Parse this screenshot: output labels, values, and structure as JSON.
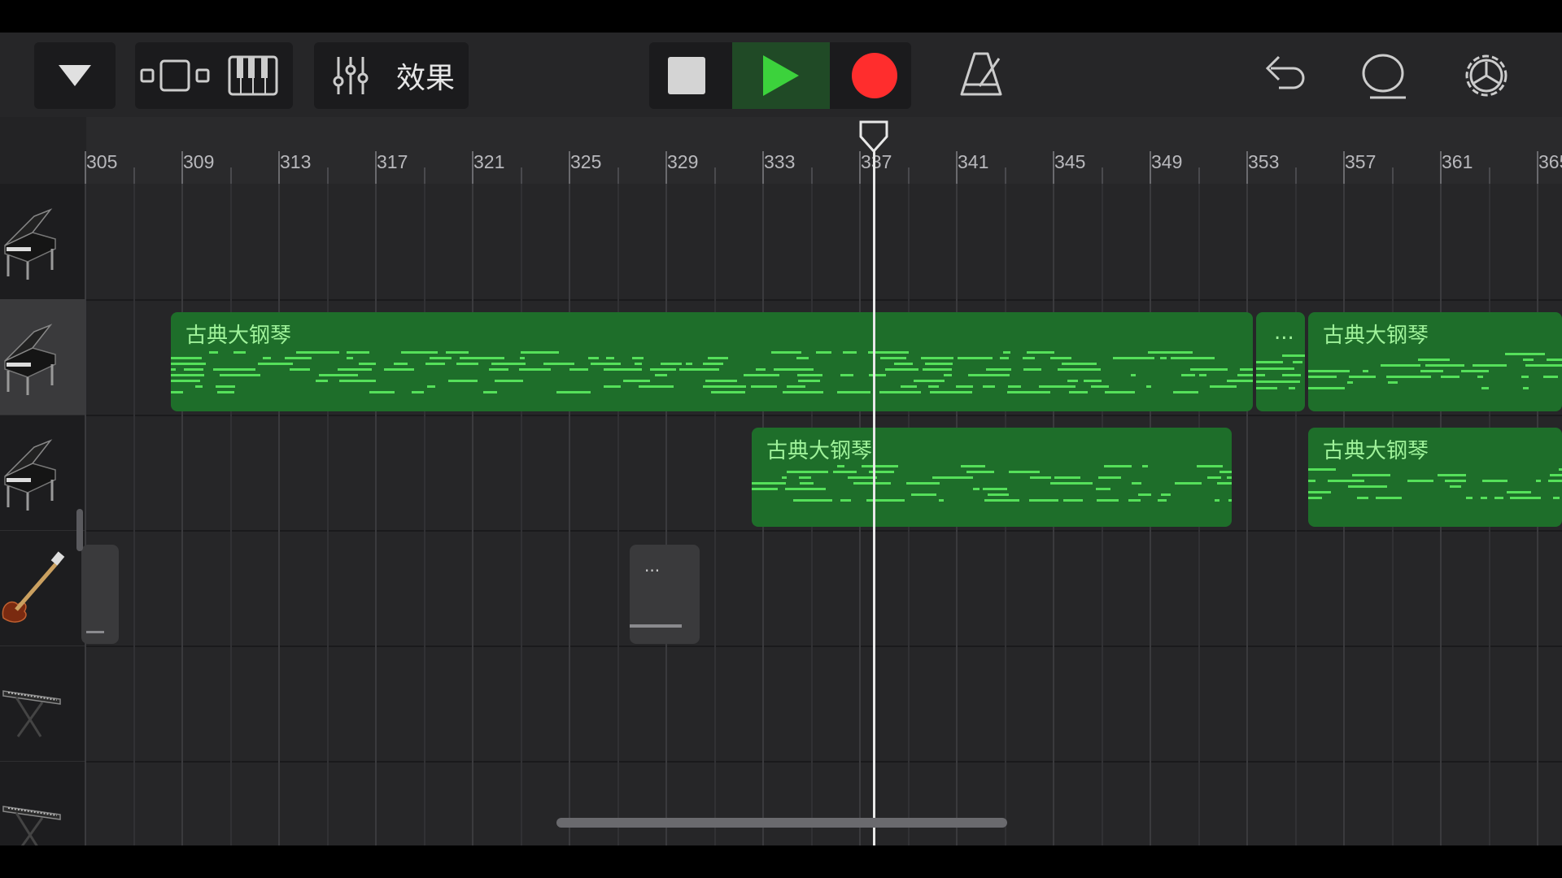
{
  "toolbar": {
    "effects_label": "效果"
  },
  "ruler": {
    "bars": [
      "305",
      "309",
      "313",
      "317",
      "321",
      "325",
      "329",
      "333",
      "337",
      "341",
      "345",
      "349",
      "353",
      "357",
      "361",
      "365"
    ]
  },
  "tracks": [
    {
      "instrument": "grand-piano"
    },
    {
      "instrument": "grand-piano",
      "selected": true
    },
    {
      "instrument": "grand-piano"
    },
    {
      "instrument": "electric-bass"
    },
    {
      "instrument": "synth-keyboard"
    },
    {
      "instrument": "synth-keyboard"
    }
  ],
  "regions": [
    {
      "label": "古典大钢琴"
    },
    {
      "label": "..."
    },
    {
      "label": "古典大钢琴"
    },
    {
      "label": "古典大钢琴"
    },
    {
      "label": "古典大钢琴"
    },
    {
      "label": "..."
    }
  ],
  "colors": {
    "region_green": "#1e6e2a",
    "note_green": "#55e05a",
    "play_green": "#3cd23c",
    "record_red": "#ff2d2d"
  }
}
